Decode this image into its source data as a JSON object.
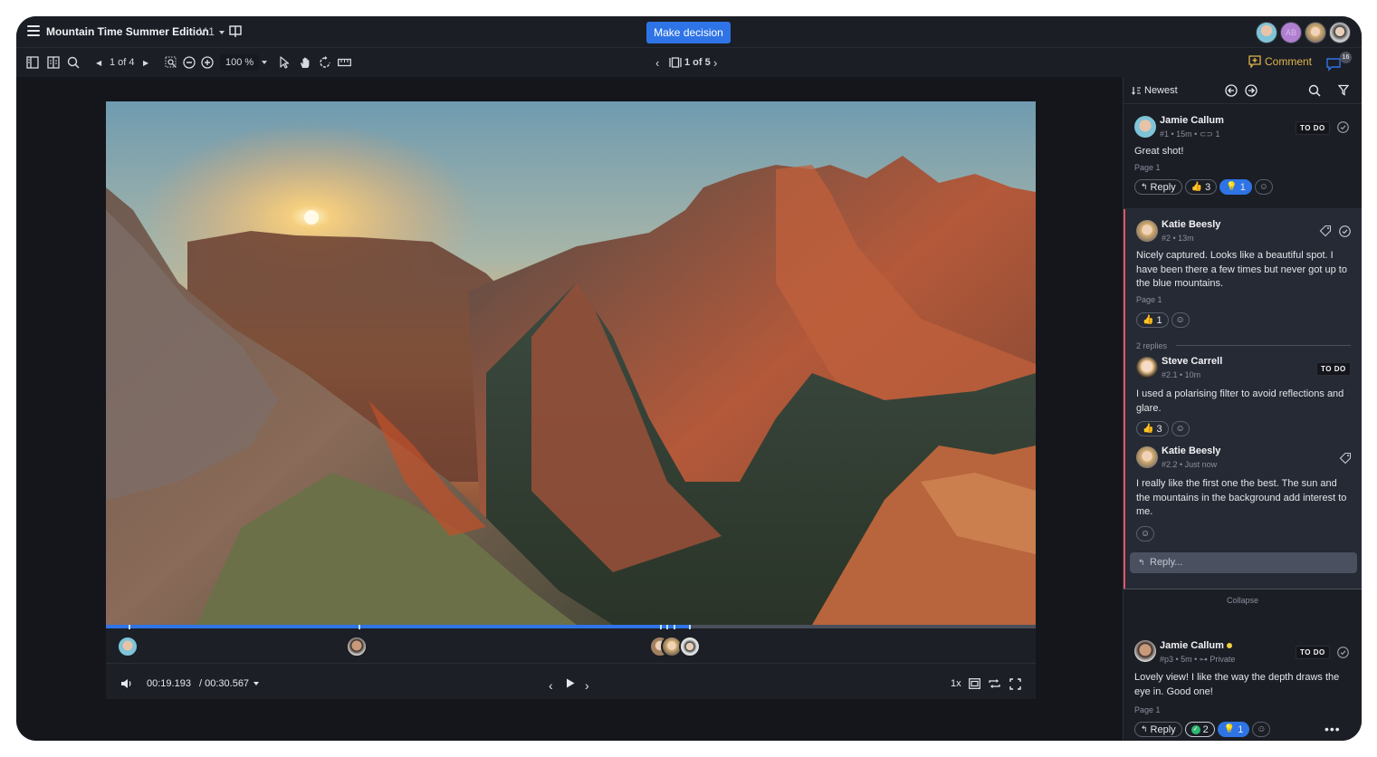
{
  "header": {
    "title": "Mountain Time Summer Edition",
    "version": "V.1",
    "decision_button": "Make decision",
    "collaborators": [
      {
        "name": "Jamie Callum",
        "initials": "",
        "color": "#7fc4d8"
      },
      {
        "name": "AB",
        "initials": "AB",
        "color": "#b07fd0"
      },
      {
        "name": "Katie Beesly",
        "initials": "",
        "color": "#c9a37a"
      },
      {
        "name": "Steve Carrell",
        "initials": "",
        "color": "#9a9a9a"
      }
    ]
  },
  "toolbar": {
    "page_indicator": "1 of 4",
    "zoom_level": "100 %",
    "asset_indicator": "1 of 5",
    "comment_label": "Comment",
    "comments_count": "16",
    "accent_color": "#e0b44c"
  },
  "player": {
    "current_time": "00:19.193",
    "duration": "/ 00:30.567",
    "speed": "1x",
    "progress_fraction": 0.628
  },
  "sidebar": {
    "sort_label": "Newest",
    "comments": [
      {
        "author": "Jamie Callum",
        "meta": "#1 • 15m • ",
        "attachments": "1",
        "text": "Great shot!",
        "page": "Page 1",
        "status": "TO DO",
        "reply_label": "Reply",
        "likes": "3",
        "ideas": "1"
      },
      {
        "author": "Katie Beesly",
        "meta": "#2 • 13m",
        "text": "Nicely captured. Looks like a beautiful spot. I have been there a few times but never got up to the blue mountains.",
        "page": "Page 1",
        "likes": "1",
        "replies_label": "2 replies",
        "replies": [
          {
            "author": "Steve Carrell",
            "meta": "#2.1 • 10m",
            "text": "I used a polarising filter to avoid reflections and glare.",
            "status": "TO DO",
            "likes": "3"
          },
          {
            "author": "Katie Beesly",
            "meta": "#2.2 • Just now",
            "text": "I really like the first one the best. The sun and the mountains in the background add interest to me."
          }
        ],
        "reply_placeholder": "Reply...",
        "collapse_label": "Collapse"
      },
      {
        "author": "Jamie Callum",
        "meta": "#p3 • 5m • ",
        "private_label": "Private",
        "text": "Lovely view! I like the way the depth draws the eye in. Good one!",
        "page": "Page 1",
        "status": "TO DO",
        "reply_label": "Reply",
        "approvals": "2",
        "ideas": "1"
      }
    ]
  }
}
